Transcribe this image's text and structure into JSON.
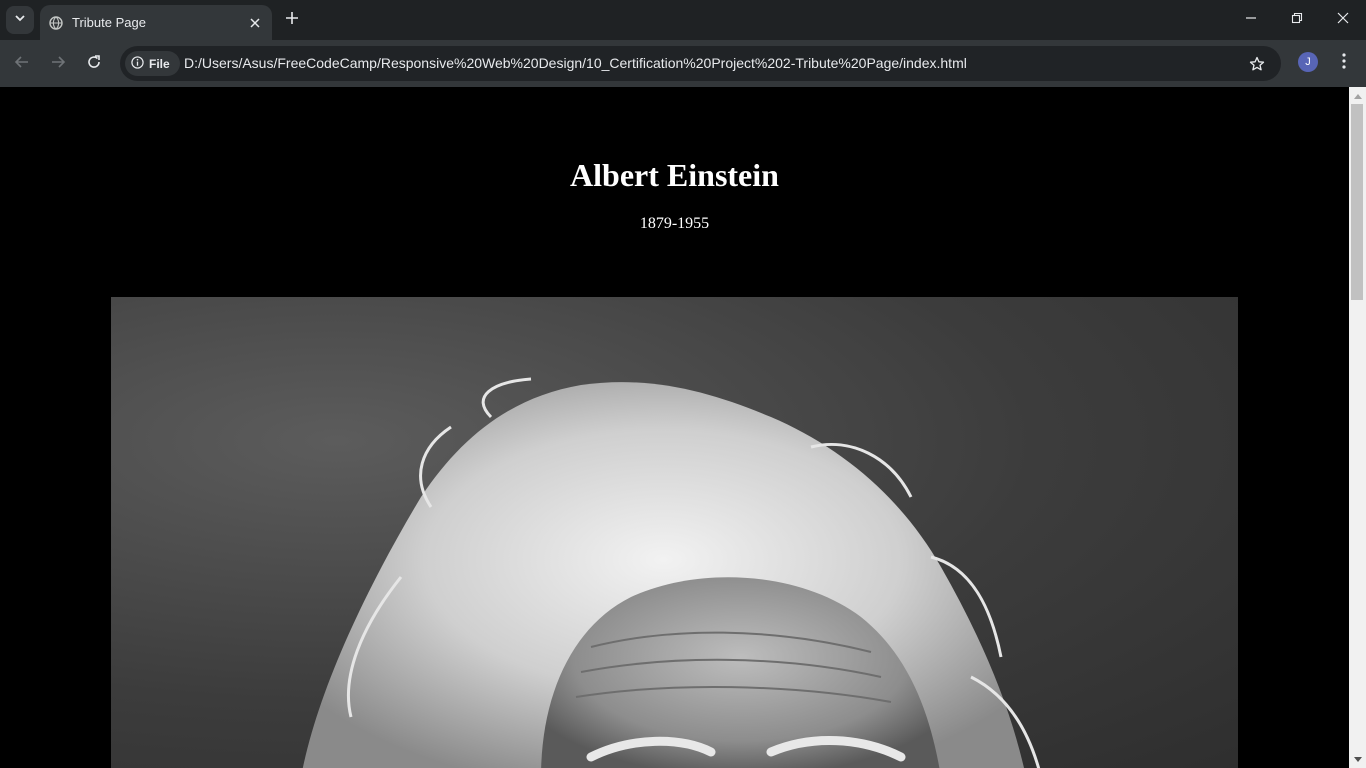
{
  "browser": {
    "tab": {
      "title": "Tribute Page"
    },
    "address": {
      "scheme_label": "File",
      "url": "D:/Users/Asus/FreeCodeCamp/Responsive%20Web%20Design/10_Certification%20Project%202-Tribute%20Page/index.html"
    },
    "profile_initial": "J"
  },
  "page": {
    "title": "Albert Einstein",
    "subtitle": "1879-1955"
  },
  "colors": {
    "page_background": "#000000",
    "chrome_dark": "#1f2224",
    "chrome_toolbar": "#33373a",
    "text_light": "#e8eaed",
    "avatar": "#5865b6"
  }
}
